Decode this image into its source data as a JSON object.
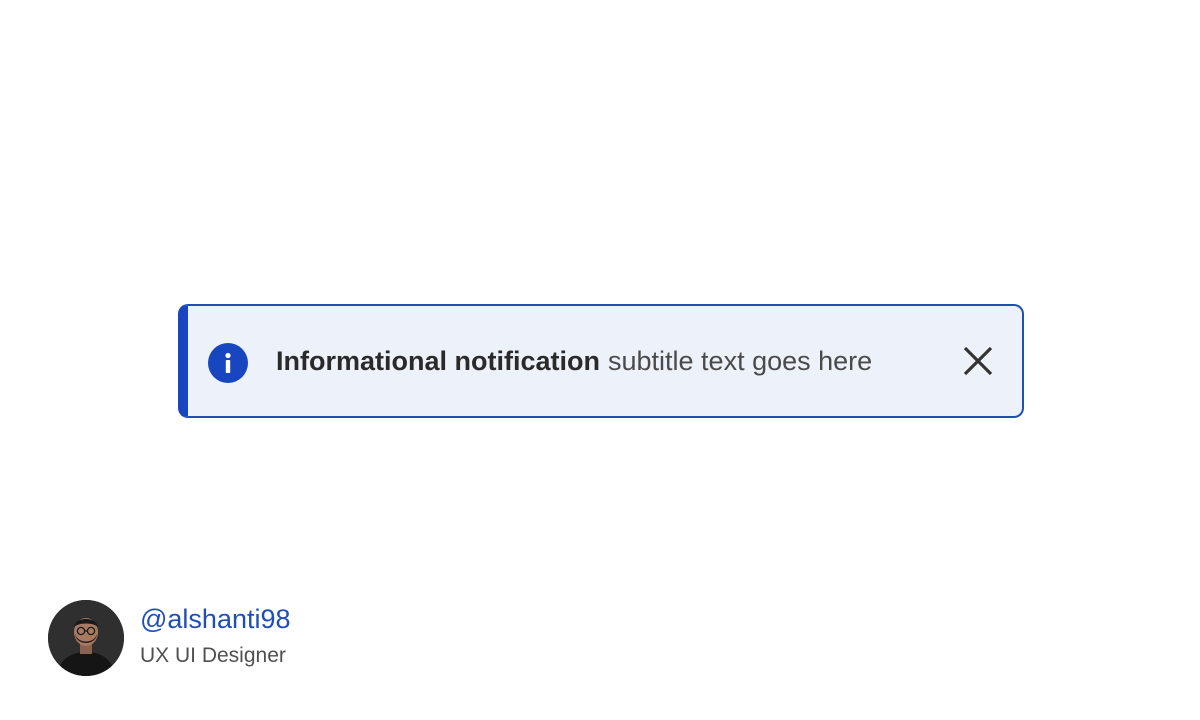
{
  "notification": {
    "title": "Informational notification",
    "subtitle": "subtitle text goes here",
    "icon": "info-icon",
    "close_icon": "close-icon",
    "colors": {
      "accent": "#1746c0",
      "background": "#edf2fa",
      "border": "#1f4fb5"
    }
  },
  "author": {
    "handle": "@alshanti98",
    "role": "UX UI Designer",
    "avatar_icon": "avatar"
  }
}
